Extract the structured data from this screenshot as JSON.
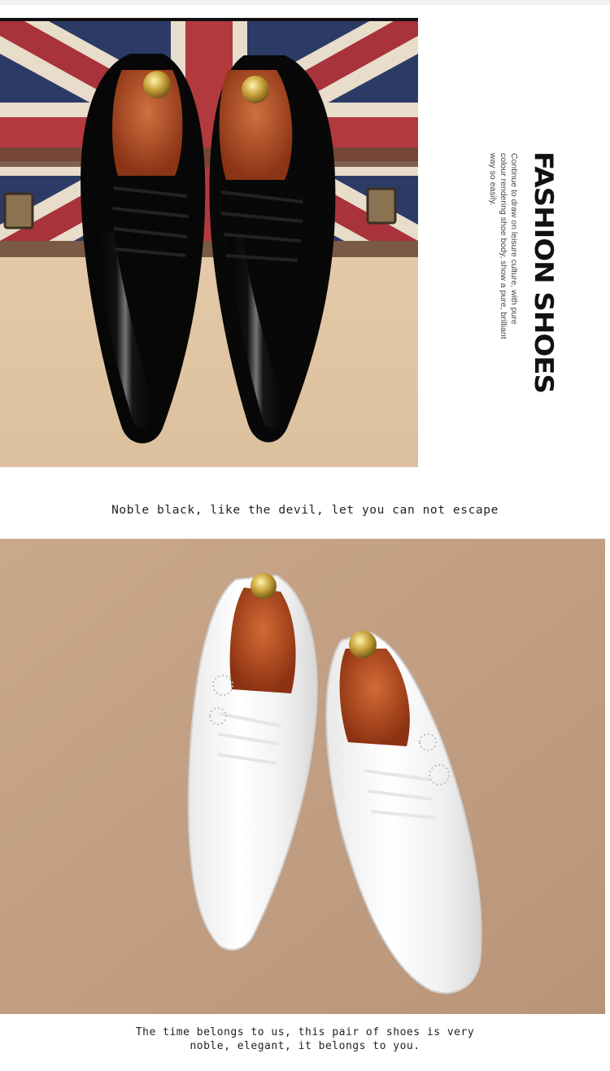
{
  "feature": {
    "title": "FASHION SHOES",
    "description": "Continue to draw on leisure culture, with pure colour rendering shoe body, show a pure, brilliant way so easily."
  },
  "captions": {
    "black": "Noble black, like the devil, let you can not escape",
    "white": "The time belongs to us, this pair of shoes is very noble, elegant, it belongs to you."
  },
  "colors": {
    "black_shoe": "#0b0b0b",
    "white_shoe": "#f7f7f7",
    "lining": "#b8532a",
    "floor_beige": "#e2c8a6",
    "backdrop_tan": "#c9a588"
  }
}
